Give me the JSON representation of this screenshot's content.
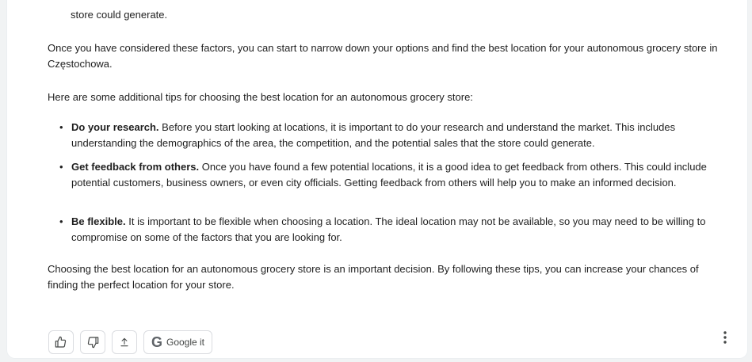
{
  "response": {
    "cut_top_text": "store could generate.",
    "para_considered": "Once you have considered these factors, you can start to narrow down your options and find the best location for your autonomous grocery store in Częstochowa.",
    "para_tips_intro": "Here are some additional tips for choosing the best location for an autonomous grocery store:",
    "tips": [
      {
        "title": "Do your research.",
        "body": "Before you start looking at locations, it is important to do your research and understand the market. This includes understanding the demographics of the area, the competition, and the potential sales that the store could generate."
      },
      {
        "title": "Get feedback from others.",
        "body": "Once you have found a few potential locations, it is a good idea to get feedback from others. This could include potential customers, business owners, or even city officials. Getting feedback from others will help you to make an informed decision."
      },
      {
        "title": "Be flexible.",
        "body": "It is important to be flexible when choosing a location. The ideal location may not be available, so you may need to be willing to compromise on some of the factors that you are looking for."
      }
    ],
    "para_conclusion": "Choosing the best location for an autonomous grocery store is an important decision. By following these tips, you can increase your chances of finding the perfect location for your store."
  },
  "actions": {
    "thumbs_up_icon": "thumbs-up-icon",
    "thumbs_down_icon": "thumbs-down-icon",
    "share_icon": "share-icon",
    "google_it_label": "Google it",
    "more_icon": "more-vert-icon"
  }
}
